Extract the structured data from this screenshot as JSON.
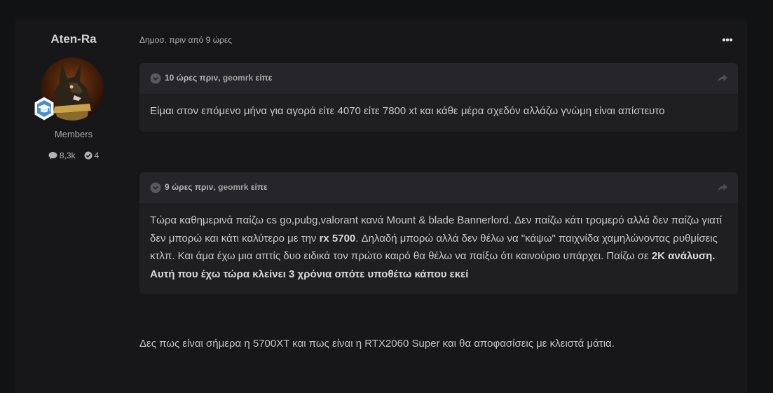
{
  "author": {
    "name": "Aten-Ra",
    "group": "Members",
    "posts_count": "8,3k",
    "reputation": "4",
    "avatar_icon": "anubis-avatar-icon",
    "rank_icon": "graduation-cap-badge-icon"
  },
  "post": {
    "meta": "Δημοσ. πριν από 9 ώρες",
    "more_icon": "ellipsis-icon"
  },
  "quotes": [
    {
      "time": "10 ώρες πριν,",
      "user": "geomrk",
      "said": "είπε",
      "body": "Είμαι στον επόμενο μήνα για αγορά είτε 4070 είτε 7800 xt και κάθε μέρα σχεδόν αλλάζω γνώμη είναι απίστευτο"
    },
    {
      "time": "9 ώρες πριν,",
      "user": "geomrk",
      "said": "είπε",
      "body_parts": {
        "p1": "Τώρα καθημερινά παίζω cs go,pubg,valorant κανά Mount & blade Bannerlord. Δεν παίζω κάτι τρομερό αλλά δεν παίζω γιατί δεν μπορώ και κάτι καλύτερο με την ",
        "b1": "rx 5700",
        "p2": ". Δηλαδή μπορώ αλλά δεν θέλω να \"κάψω\" παιχνίδα χαμηλώνοντας ρυθμίσεις κτλπ. Και άμα έχω μια απτίς δυο ειδικά τον πρώτο καιρό θα θέλω να παίξω ότι καινούριο υπάρχει. Παίζω σε ",
        "b2": "2K ανάλυση",
        "b3": ". Αυτή που έχω τώρα κλείνει 3 χρόνια οπότε υποθέτω κάπου εκεί"
      }
    }
  ],
  "reply_text": "Δες πως είναι σήμερα η 5700XT και πως είναι η RTX2060 Super και θα αποφασίσεις με κλειστά μάτια."
}
